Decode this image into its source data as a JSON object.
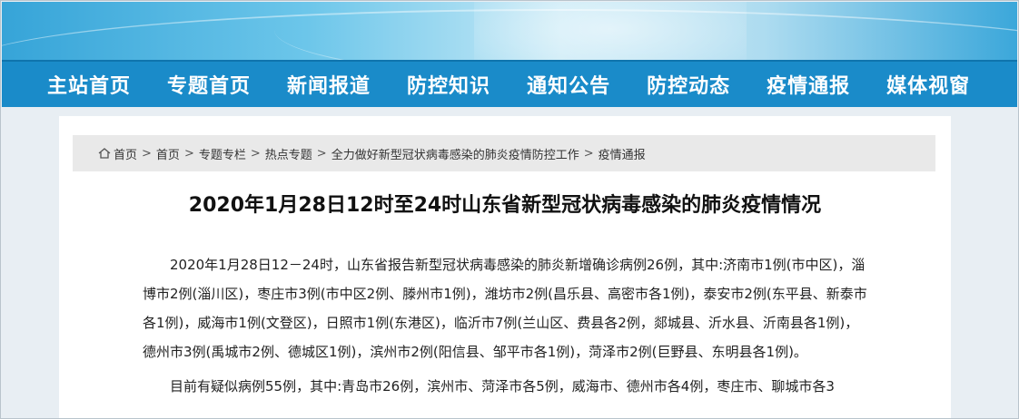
{
  "nav": {
    "items": [
      "主站首页",
      "专题首页",
      "新闻报道",
      "防控知识",
      "通知公告",
      "防控动态",
      "疫情通报",
      "媒体视窗"
    ]
  },
  "breadcrumb": {
    "items": [
      "首页",
      "首页",
      "专题专栏",
      "热点专题",
      "全力做好新型冠状病毒感染的肺炎疫情防控工作",
      "疫情通报"
    ]
  },
  "article": {
    "title": "2020年1月28日12时至24时山东省新型冠状病毒感染的肺炎疫情情况",
    "paragraphs": [
      "2020年1月28日12－24时，山东省报告新型冠状病毒感染的肺炎新增确诊病例26例，其中:济南市1例(市中区)，淄博市2例(淄川区)，枣庄市3例(市中区2例、滕州市1例)，潍坊市2例(昌乐县、高密市各1例)，泰安市2例(东平县、新泰市各1例)，威海市1例(文登区)，日照市1例(东港区)，临沂市7例(兰山区、费县各2例，郯城县、沂水县、沂南县各1例)，德州市3例(禹城市2例、德城区1例)，滨州市2例(阳信县、邹平市各1例)，菏泽市2例(巨野县、东明县各1例)。",
      "目前有疑似病例55例，其中:青岛市26例，滨州市、菏泽市各5例，威海市、德州市各4例，枣庄市、聊城市各3"
    ]
  },
  "colors": {
    "nav_bg": "#1a8bc9",
    "breadcrumb_bg": "#e9e9e9"
  }
}
